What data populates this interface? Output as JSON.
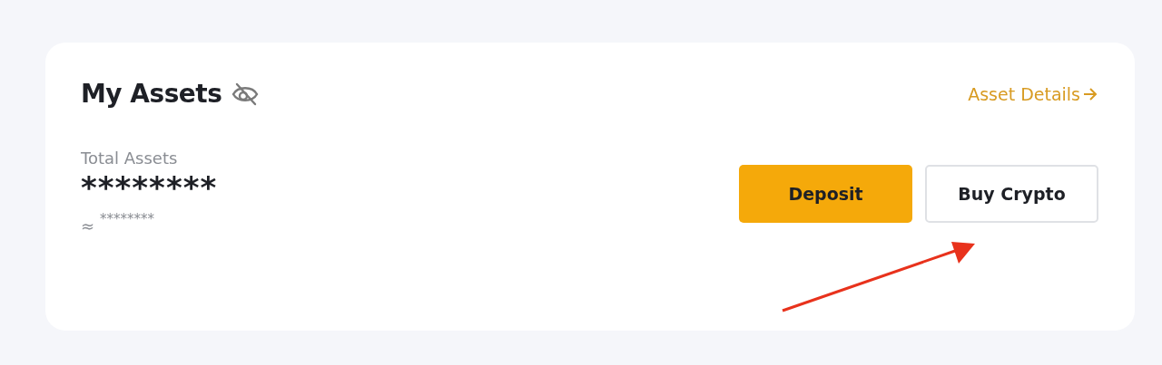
{
  "card": {
    "title": "My Assets",
    "link": "Asset Details",
    "total_label": "Total Assets",
    "total_value": "********",
    "approx_prefix": "≈",
    "approx_value": "********",
    "buttons": [
      {
        "label": "Deposit",
        "kind": "primary"
      },
      {
        "label": "Buy Crypto",
        "kind": "secondary"
      }
    ]
  }
}
